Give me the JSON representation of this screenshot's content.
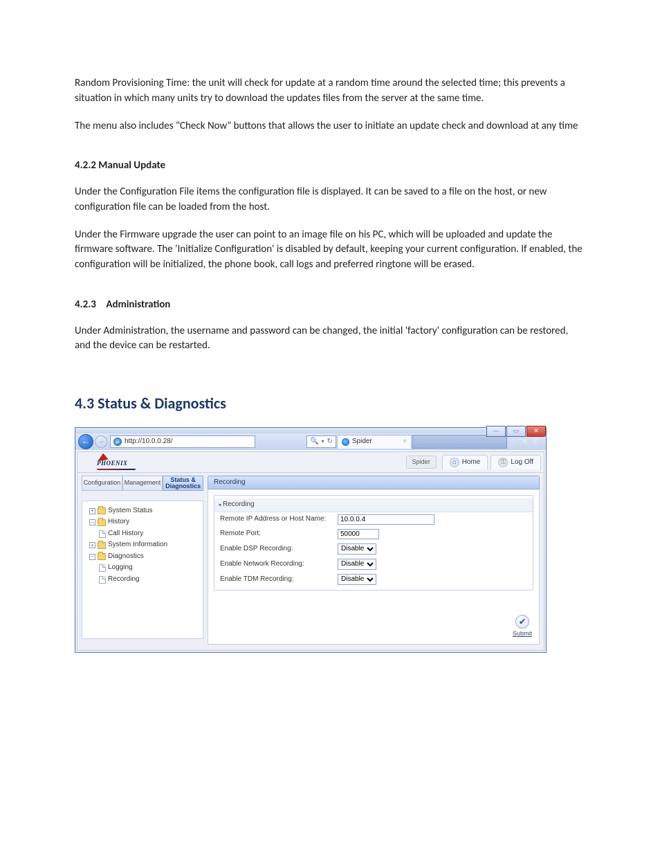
{
  "doc": {
    "p1": "Random Provisioning Time: the unit will check for update at a random time around the selected time; this prevents a situation in which many units try to download the updates files from the server at the same time.",
    "p2": "The menu also includes \"Check Now\" buttons that allows the user to initiate an update check and download at any time",
    "h422": "4.2.2 Manual Update",
    "p3": "Under the Configuration File items the configuration file is displayed. It can be saved to a file on the host, or new configuration file can be loaded from the host.",
    "p4": "Under the Firmware upgrade the user can point to an image file on his PC, which will be uploaded and update the firmware software. The 'Initialize Configuration' is disabled by default, keeping your current configuration. If enabled, the configuration will be initialized, the phone book, call logs and preferred ringtone will be erased.",
    "h423_num": "4.2.3",
    "h423_title": "Administration",
    "p5": "Under Administration, the username and password can be changed, the initial 'factory' configuration can be restored, and the device can be restarted.",
    "h43": "4.3 Status & Diagnostics"
  },
  "browser": {
    "url": "http://10.0.0.28/",
    "tab_title": "Spider"
  },
  "header": {
    "logo_text": "PHOENIX",
    "device_label": "Spider",
    "home": "Home",
    "logoff": "Log Off"
  },
  "left_tabs": {
    "t1": "Configuration",
    "t2": "Management",
    "t3": "Status & Diagnostics"
  },
  "tree": {
    "n1": "System Status",
    "n2": "History",
    "n2a": "Call History",
    "n3": "System Information",
    "n4": "Diagnostics",
    "n4a": "Logging",
    "n4b": "Recording"
  },
  "panel": {
    "title": "Recording",
    "legend": "Recording",
    "rows": {
      "remote_host_lbl": "Remote IP Address or Host Name:",
      "remote_host_val": "10.0.0.4",
      "remote_port_lbl": "Remote Port:",
      "remote_port_val": "50000",
      "dsp_lbl": "Enable DSP Recording:",
      "net_lbl": "Enable Network Recording:",
      "tdm_lbl": "Enable TDM Recording:",
      "disable_opt": "Disable"
    },
    "submit": "Submit"
  }
}
